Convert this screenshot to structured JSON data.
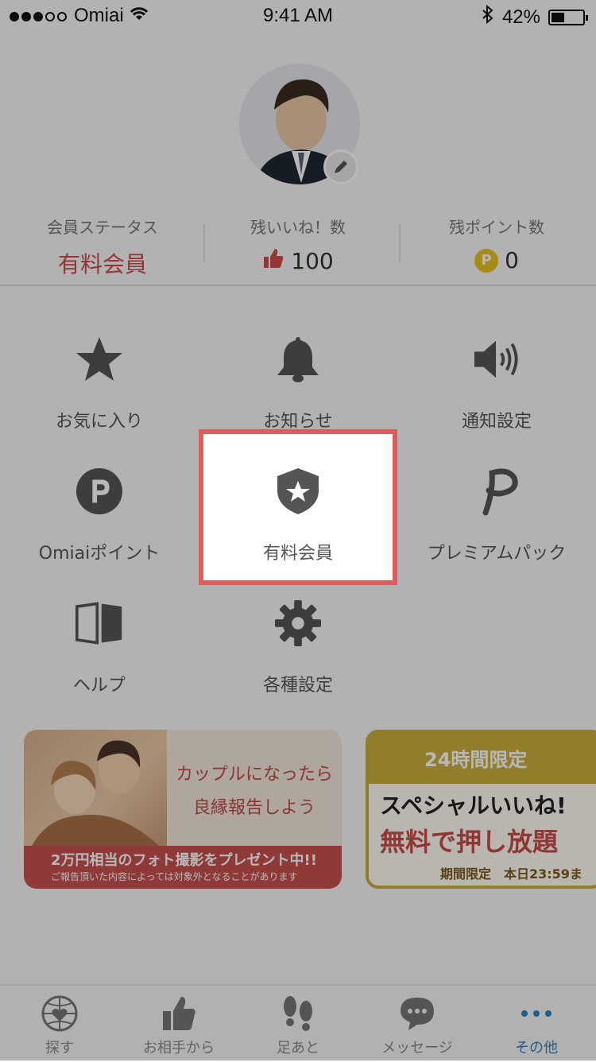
{
  "status_bar": {
    "carrier": "Omiai",
    "time": "9:41 AM",
    "battery": "42%"
  },
  "profile": {
    "stats": [
      {
        "label": "会員ステータス",
        "value": "有料会員"
      },
      {
        "label": "残いいね！数",
        "value": "100"
      },
      {
        "label": "残ポイント数",
        "value": "0"
      }
    ]
  },
  "menu": [
    {
      "label": "お気に入り",
      "icon": "star-icon"
    },
    {
      "label": "お知らせ",
      "icon": "bell-icon"
    },
    {
      "label": "通知設定",
      "icon": "speaker-icon"
    },
    {
      "label": "Omiaiポイント",
      "icon": "point-icon"
    },
    {
      "label": "有料会員",
      "icon": "shield-star-icon"
    },
    {
      "label": "プレミアムパック",
      "icon": "premium-p-icon"
    },
    {
      "label": "ヘルプ",
      "icon": "book-icon"
    },
    {
      "label": "各種設定",
      "icon": "gear-icon"
    }
  ],
  "banners": {
    "left": {
      "line1": "カップルになったら",
      "line2": "良縁報告しよう",
      "strip_main": "2万円相当のフォト撮影をプレゼント中!!",
      "strip_sub": "ご報告頂いた内容によっては対象外となることがあります"
    },
    "right": {
      "header": "24時間限定",
      "line1": "スペシャルいいね!",
      "line2": "無料で押し放題",
      "footer": "期間限定　本日23:59ま"
    }
  },
  "tabs": [
    {
      "label": "探す",
      "icon": "globe-heart-icon"
    },
    {
      "label": "お相手から",
      "icon": "thumbs-up-icon"
    },
    {
      "label": "足あと",
      "icon": "footprints-icon"
    },
    {
      "label": "メッセージ",
      "icon": "chat-bubble-icon"
    },
    {
      "label": "その他",
      "icon": "more-dots-icon"
    }
  ],
  "colors": {
    "accent_red": "#e05b5b",
    "tab_active": "#2c82c9",
    "coin": "#e6c21d"
  }
}
